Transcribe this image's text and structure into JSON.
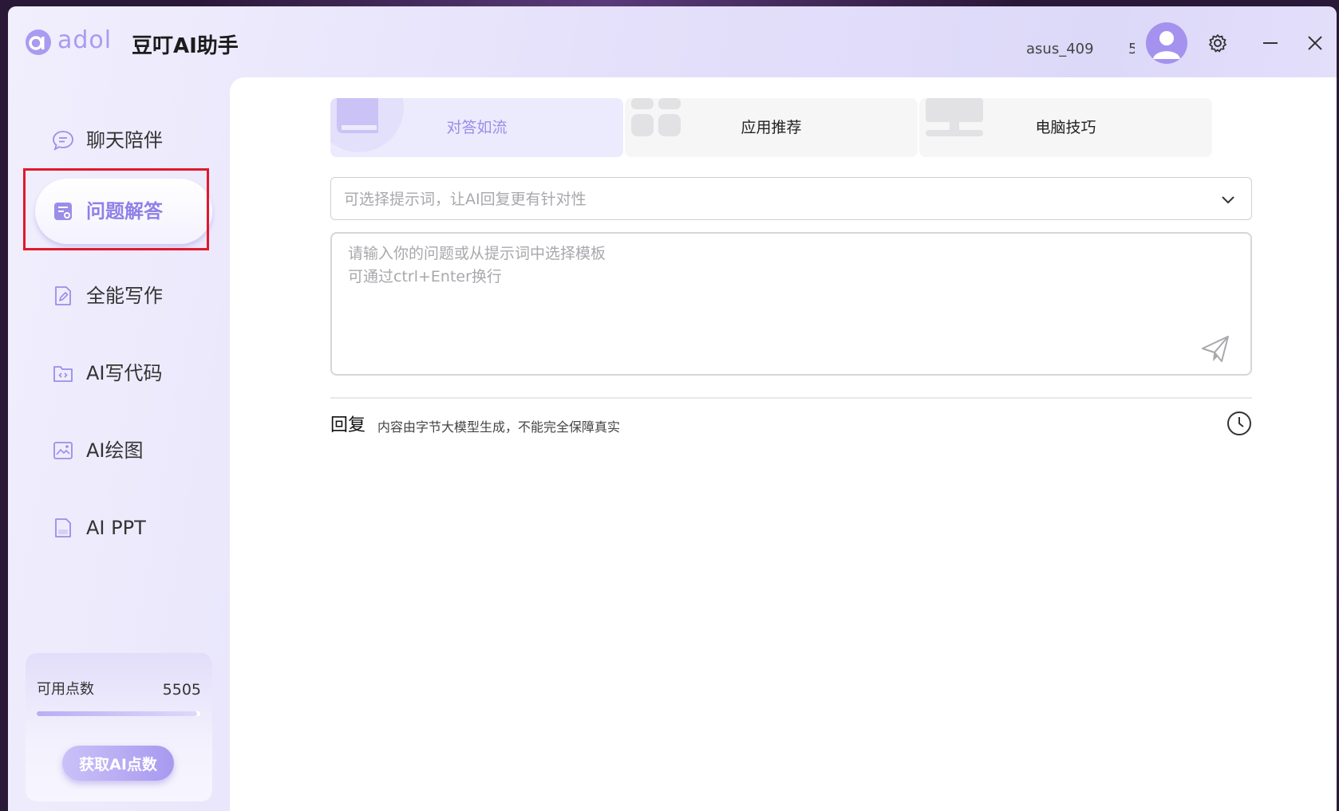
{
  "header": {
    "logo_text": "adol",
    "app_title": "豆叮AI助手",
    "username": "asus_409",
    "username_tail": "5",
    "icons": [
      "settings-icon",
      "minimize-icon",
      "close-icon"
    ]
  },
  "sidebar": {
    "items": [
      {
        "label": "聊天陪伴",
        "icon": "chat-bubble-icon"
      },
      {
        "label": "问题解答",
        "icon": "question-doc-icon",
        "active": true
      },
      {
        "label": "全能写作",
        "icon": "write-doc-icon"
      },
      {
        "label": "AI写代码",
        "icon": "code-folder-icon"
      },
      {
        "label": "AI绘图",
        "icon": "image-icon"
      },
      {
        "label": "AI PPT",
        "icon": "ppt-file-icon"
      }
    ],
    "points": {
      "label": "可用点数",
      "value": "5505",
      "level": 0.98,
      "button_label": "获取AI点数"
    }
  },
  "main": {
    "tabs": [
      {
        "label": "对答如流",
        "active": true
      },
      {
        "label": "应用推荐"
      },
      {
        "label": "电脑技巧"
      }
    ],
    "prompt_select": {
      "placeholder": "可选择提示词，让AI回复更有针对性"
    },
    "question": {
      "placeholder_line1": "请输入你的问题或从提示词中选择模板",
      "placeholder_line2": "可通过ctrl+Enter换行"
    },
    "reply": {
      "title": "回复",
      "note": "内容由字节大模型生成，不能完全保障真实"
    }
  },
  "colors": {
    "accent": "#9a8ee8",
    "highlight_border": "#e0192c"
  }
}
